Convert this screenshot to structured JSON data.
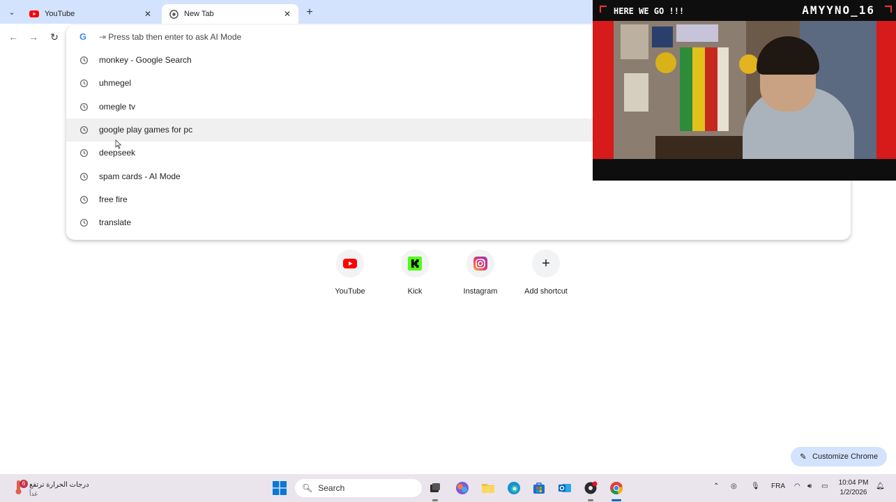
{
  "tabs": [
    {
      "title": "YouTube",
      "icon": "youtube-favicon-icon",
      "active": false
    },
    {
      "title": "New Tab",
      "icon": "chrome-favicon-icon",
      "active": true
    }
  ],
  "omnibox": {
    "placeholder": "Press tab then enter to ask AI Mode",
    "suggestions": [
      "monkey - Google Search",
      "uhmegel",
      "omegle tv",
      "google play games for pc",
      "deepseek",
      "spam cards - AI Mode",
      "free fire",
      "translate"
    ],
    "hovered_index": 3
  },
  "shortcuts": [
    {
      "label": "YouTube",
      "icon": "youtube-icon"
    },
    {
      "label": "Kick",
      "icon": "kick-icon"
    },
    {
      "label": "Instagram",
      "icon": "instagram-icon"
    },
    {
      "label": "Add shortcut",
      "icon": "plus-icon"
    }
  ],
  "customize_label": "Customize Chrome",
  "stream": {
    "title": "HERE WE GO !!!",
    "streamer_name": "AMYYNO_16"
  },
  "taskbar": {
    "weather_line1": "درجات الحرارة ترتفع",
    "weather_line2": "غداً",
    "weather_badge": "6",
    "search_label": "Search",
    "language": "FRA",
    "time": "10:04 PM",
    "date": "1/2/2026"
  },
  "colors": {
    "tabstrip": "#d3e3fd",
    "stream_red": "#d71a1a",
    "taskbar": "#eae4ed",
    "youtube_red": "#ff0000",
    "kick_green": "#53fc18"
  }
}
